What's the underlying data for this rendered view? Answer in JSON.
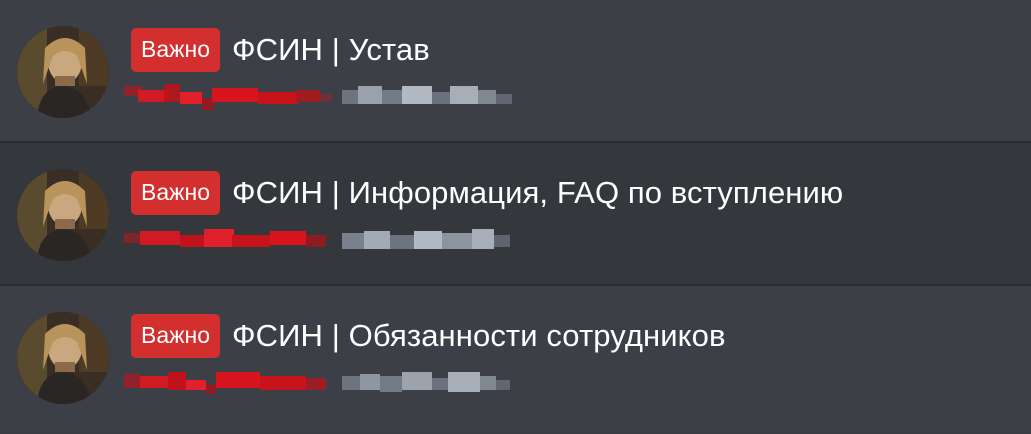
{
  "threads": [
    {
      "badge": "Важно",
      "title": "ФСИН | Устав",
      "author_redacted": true,
      "date_redacted": true,
      "avatar_icon": "user-avatar"
    },
    {
      "badge": "Важно",
      "title": "ФСИН | Информация, FAQ по вступлению",
      "author_redacted": true,
      "date_redacted": true,
      "avatar_icon": "user-avatar"
    },
    {
      "badge": "Важно",
      "title": "ФСИН | Обязанности сотрудников",
      "author_redacted": true,
      "date_redacted": true,
      "avatar_icon": "user-avatar"
    }
  ],
  "colors": {
    "badge_bg": "#d32f2f",
    "row_bg": "#3c3f45",
    "row_bg_alt": "#34373c",
    "title_text": "#ffffff",
    "redacted_author": "#c0161c",
    "redacted_date": "#8a919c"
  }
}
